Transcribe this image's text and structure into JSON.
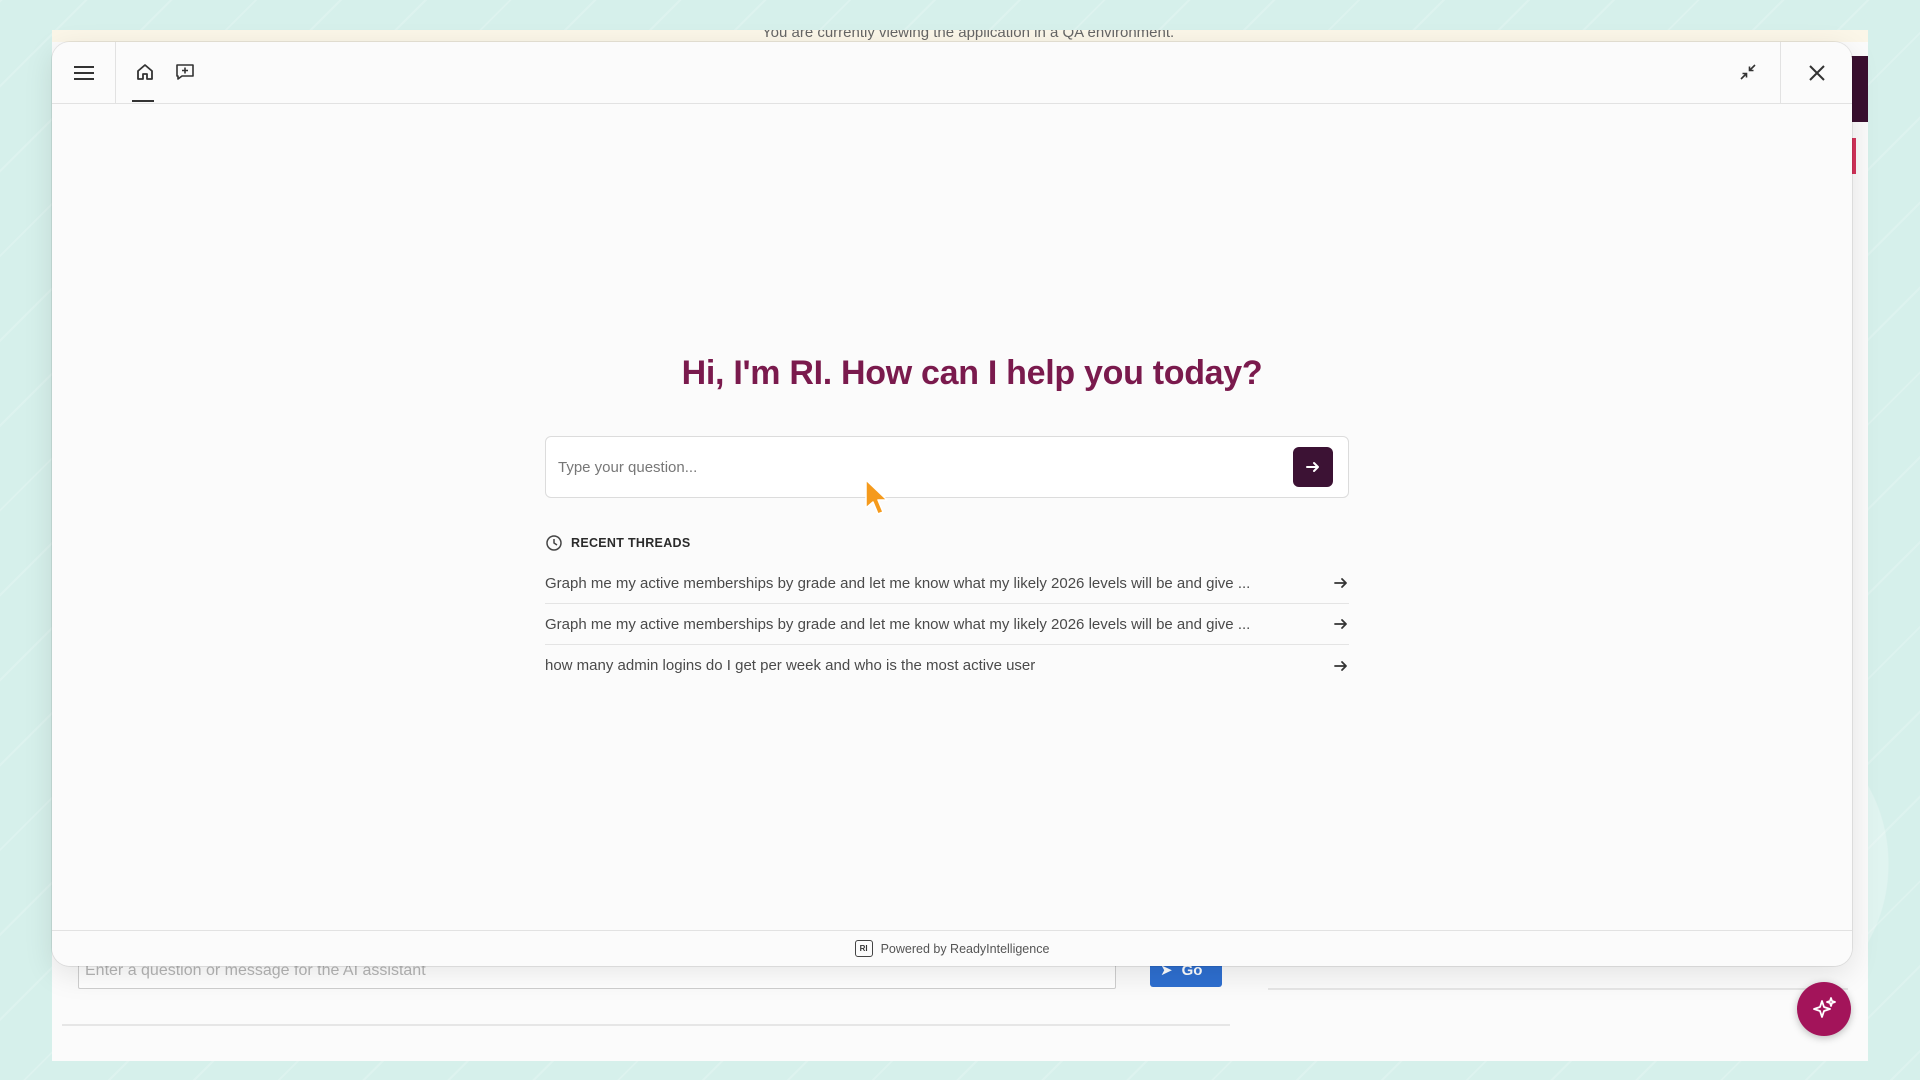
{
  "background_app": {
    "qa_banner_text": "You are currently viewing the application in a QA environment.",
    "chat_input_placeholder": "Enter a question or message for the AI assistant",
    "go_button_label": "Go"
  },
  "assistant": {
    "greeting": "Hi, I'm RI. How can I help you today?",
    "question_placeholder": "Type your question...",
    "recent_threads_title": "RECENT THREADS",
    "threads": [
      {
        "text": "Graph me my active memberships by grade and let me know what my likely 2026 levels will be and give ..."
      },
      {
        "text": "Graph me my active memberships by grade and let me know what my likely 2026 levels will be and give ..."
      },
      {
        "text": "how many admin logins do I get per week and who is the most active user"
      }
    ],
    "footer_logo_text": "RI",
    "footer_text": "Powered by ReadyIntelligence"
  },
  "icons": {
    "menu": "menu-icon",
    "home": "home-icon",
    "new_chat": "new-chat-icon",
    "collapse": "collapse-icon",
    "close": "close-icon",
    "send": "arrow-right-icon",
    "history": "history-icon",
    "thread_arrow": "arrow-right-icon",
    "assistant_fab": "sparkle-icon"
  },
  "colors": {
    "greeting": "#7a1a4d",
    "send_button": "#3c1234",
    "fab": "#a3145a",
    "go_button": "#2e6fd0",
    "background": "#d6f0eb"
  }
}
